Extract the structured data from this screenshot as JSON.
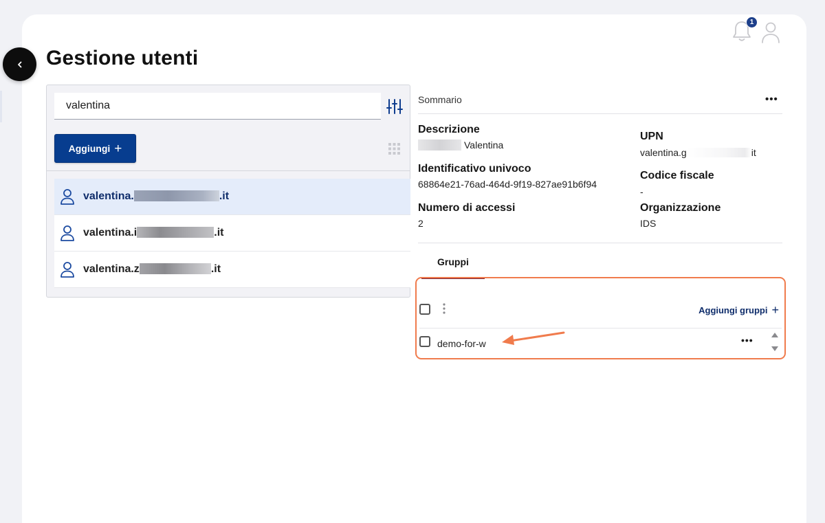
{
  "header": {
    "title": "Gestione utenti",
    "notifications_count": "1"
  },
  "search": {
    "value": "valentina"
  },
  "toolbar": {
    "add_label": "Aggiungi",
    "add_plus": "+"
  },
  "users": [
    {
      "prefix": "valentina.",
      "suffix": ".it",
      "selected": true
    },
    {
      "prefix": "valentina.i",
      "suffix": ".it",
      "selected": false
    },
    {
      "prefix": "valentina.z",
      "suffix": ".it",
      "selected": false
    }
  ],
  "summary": {
    "label": "Sommario",
    "more": "•••",
    "descrizione_label": "Descrizione",
    "descrizione_value": "Valentina",
    "id_label": "Identificativo univoco",
    "id_value": "68864e21-76ad-464d-9f19-827ae91b6f94",
    "accessi_label": "Numero di accessi",
    "accessi_value": "2",
    "upn_label": "UPN",
    "upn_value_start": "valentina.g",
    "upn_value_end": "it",
    "cf_label": "Codice fiscale",
    "cf_value": "-",
    "org_label": "Organizzazione",
    "org_value": "IDS"
  },
  "groups": {
    "tab_label": "Gruppi",
    "add_label": "Aggiungi gruppi",
    "add_plus": "+",
    "items": [
      {
        "name": "demo-for-w",
        "more": "•••"
      }
    ]
  },
  "colors": {
    "accent": "#073d8f",
    "highlight_border": "#f07b4c",
    "selected_row": "#e4ecfa",
    "tab_underline": "#7a1a2a"
  }
}
